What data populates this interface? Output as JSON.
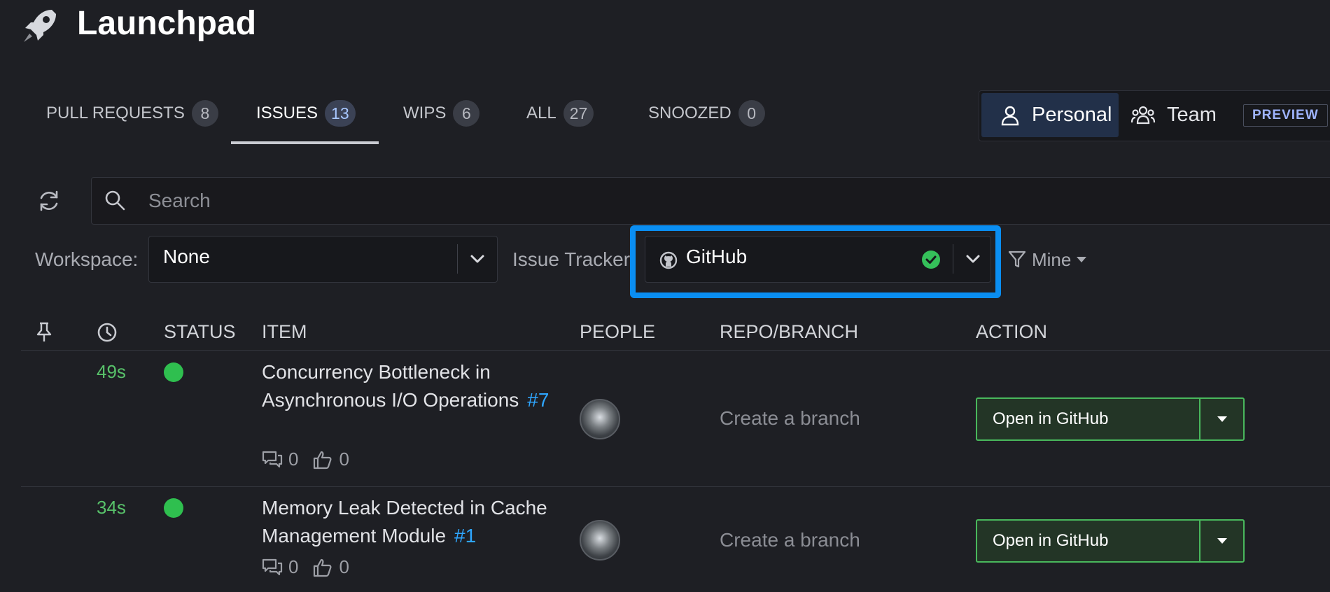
{
  "app": {
    "title": "Launchpad"
  },
  "tabs": [
    {
      "label": "PULL REQUESTS",
      "count": "8"
    },
    {
      "label": "ISSUES",
      "count": "13"
    },
    {
      "label": "WIPS",
      "count": "6"
    },
    {
      "label": "ALL",
      "count": "27"
    },
    {
      "label": "SNOOZED",
      "count": "0"
    }
  ],
  "active_tab": "ISSUES",
  "view_toggle": {
    "personal": "Personal",
    "team": "Team",
    "preview": "PREVIEW",
    "selected": "Personal"
  },
  "search": {
    "placeholder": "Search",
    "value": ""
  },
  "filters": {
    "workspace_label": "Workspace:",
    "workspace_value": "None",
    "tracker_label": "Issue Tracker",
    "tracker_value": "GitHub",
    "mine_label": "Mine"
  },
  "table": {
    "headers": {
      "status": "STATUS",
      "item": "ITEM",
      "people": "PEOPLE",
      "repo": "REPO/BRANCH",
      "action": "ACTION"
    },
    "rows": [
      {
        "time": "49s",
        "title": "Concurrency Bottleneck in Asynchronous I/O Operations",
        "number": "#7",
        "comments": "0",
        "likes": "0",
        "branch": "Create a branch",
        "action": "Open in GitHub"
      },
      {
        "time": "34s",
        "title": "Memory Leak Detected in Cache Management Module",
        "number": "#1",
        "comments": "0",
        "likes": "0",
        "branch": "Create a branch",
        "action": "Open in GitHub"
      }
    ]
  },
  "colors": {
    "background": "#1e1f24",
    "accent_highlight": "#0a8ef2",
    "status_green": "#2fbf4f",
    "issue_link": "#2ea6ff",
    "action_border": "#49b85c"
  },
  "icons": {
    "logo": "rocket-icon",
    "refresh": "refresh-icon",
    "search": "search-icon",
    "pin": "pin-icon",
    "clock": "clock-icon",
    "github": "github-icon",
    "check": "check-circle-icon",
    "filter": "filter-icon",
    "comments": "comments-icon",
    "likes": "thumbs-up-icon"
  }
}
